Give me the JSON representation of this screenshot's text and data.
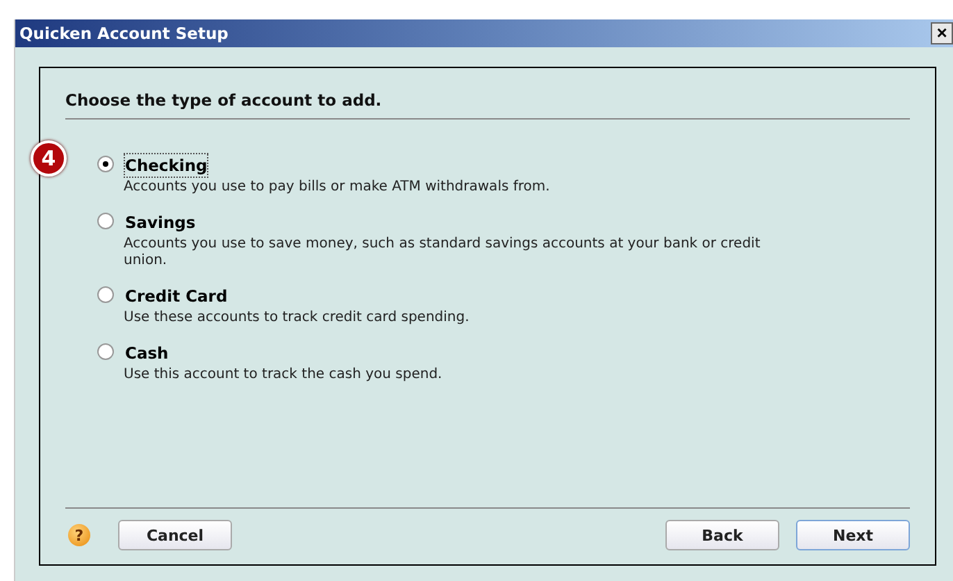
{
  "window": {
    "title": "Quicken Account Setup",
    "close": "×"
  },
  "heading": "Choose the type of account to add.",
  "step_badge": "4",
  "options": [
    {
      "label": "Checking",
      "description": "Accounts you use to pay bills or make ATM withdrawals from.",
      "selected": true
    },
    {
      "label": "Savings",
      "description": "Accounts you use to save money, such as standard savings accounts at your bank or credit union.",
      "selected": false
    },
    {
      "label": "Credit Card",
      "description": "Use these accounts to track credit card spending.",
      "selected": false
    },
    {
      "label": "Cash",
      "description": "Use this account to track the cash you spend.",
      "selected": false
    }
  ],
  "help": "?",
  "buttons": [
    {
      "label": "Cancel",
      "kind": "left"
    },
    {
      "label": "Back",
      "kind": "right"
    },
    {
      "label": "Next",
      "kind": "default"
    }
  ]
}
